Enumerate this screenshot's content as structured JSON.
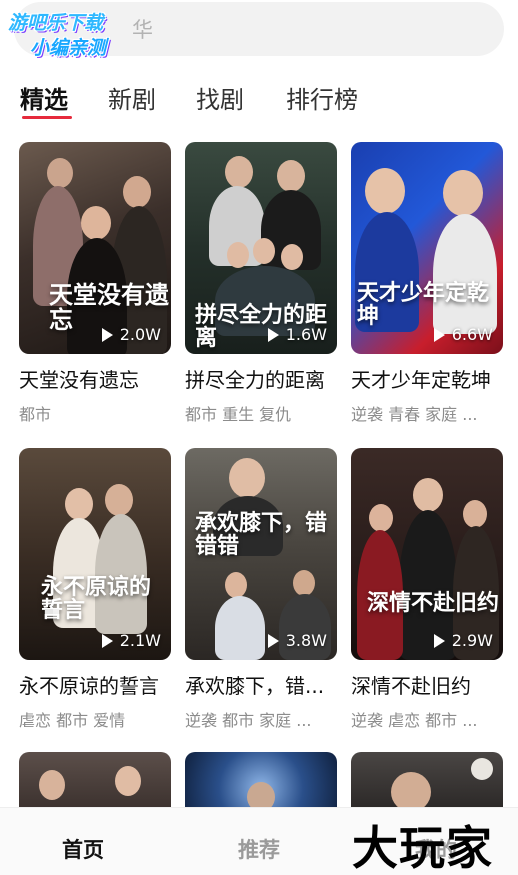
{
  "watermark": {
    "line1": "游吧乐下载",
    "line2": "小编亲测"
  },
  "search": {
    "placeholder_suffix": "华"
  },
  "tabs": [
    {
      "label": "精选",
      "active": true
    },
    {
      "label": "新剧",
      "active": false
    },
    {
      "label": "找剧",
      "active": false
    },
    {
      "label": "排行榜",
      "active": false
    }
  ],
  "dramas": [
    {
      "title": "天堂没有遗忘",
      "tags": "都市",
      "plays": "2.0W",
      "poster_text": "天堂没有遗忘"
    },
    {
      "title": "拼尽全力的距离",
      "tags": "都市 重生 复仇",
      "plays": "1.6W",
      "poster_text": "拼尽全力的距离"
    },
    {
      "title": "天才少年定乾坤",
      "tags": "逆袭 青春 家庭 ...",
      "plays": "6.6W",
      "poster_text": "天才少年定乾坤"
    },
    {
      "title": "永不原谅的誓言",
      "tags": "虐恋 都市 爱情",
      "plays": "2.1W",
      "poster_text": "永不原谅的誓言"
    },
    {
      "title": "承欢膝下，错...",
      "tags": "逆袭 都市 家庭 ...",
      "plays": "3.8W",
      "poster_text": "承欢膝下，错错错"
    },
    {
      "title": "深情不赴旧约",
      "tags": "逆袭 虐恋 都市 ...",
      "plays": "2.9W",
      "poster_text": "深情不赴旧约"
    }
  ],
  "bottom_nav": {
    "home": "首页",
    "recommend": "推荐",
    "mine": "我的"
  },
  "brand": "大玩家",
  "colors": {
    "accent": "#e62a3c",
    "inactive": "#9a9a9a"
  }
}
